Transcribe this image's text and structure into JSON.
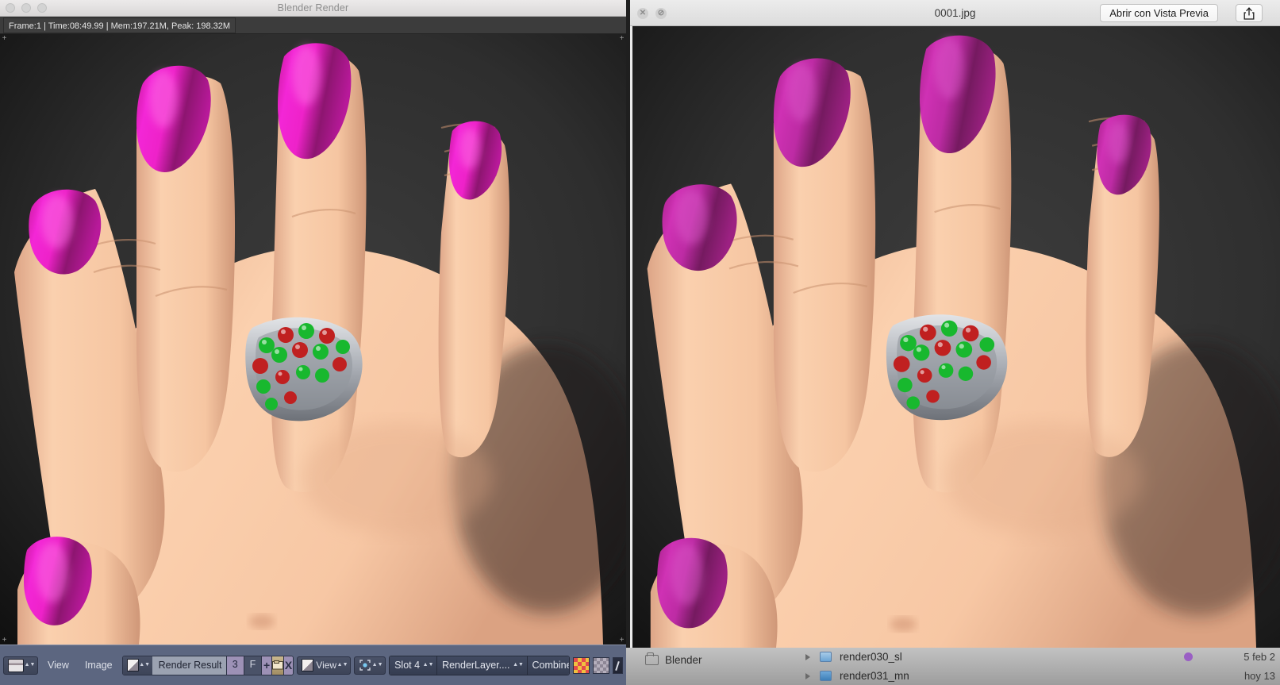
{
  "blender_window": {
    "title": "Blender Render",
    "traffic_lights": [
      "close",
      "minimize",
      "zoom"
    ],
    "status_line": "Frame:1 | Time:08:49.99 | Mem:197.21M, Peak: 198.32M",
    "status_parts": {
      "frame": "Frame:1",
      "time": "Time:08:49.99",
      "memory": "Mem:197.21M, Peak: 198.32M"
    },
    "toolbar": {
      "editor_type_icon": "image-editor-icon",
      "menus": [
        "View",
        "Image"
      ],
      "view_menu": "View",
      "image_menu": "Image",
      "datablock_icon": "image-datablock-icon",
      "datablock_name": "Render Result",
      "users_count": "3",
      "fake_user": "F",
      "new_button": "+",
      "open_button": "open-folder-icon",
      "unlink_button": "X",
      "view_dropdown_icon": "image-view-icon",
      "view_dropdown": "View",
      "pivot_icon": "pivot-center-icon",
      "slot": "Slot 4",
      "render_layer": "RenderLayer....",
      "pass": "Combined",
      "display_channels_icon": "color-channel-icon",
      "alpha_icon": "alpha-checker-icon",
      "grease_pencil_icon": "grease-pencil-icon"
    }
  },
  "preview_window": {
    "title": "0001.jpg",
    "close_icon": "close-icon",
    "disabled_icon": "no-entry-icon",
    "open_with_button": "Abrir con Vista Previa",
    "share_icon": "share-icon"
  },
  "finder": {
    "sidebar_item": "Blender",
    "sidebar_folder_icon": "folder-icon",
    "rows": [
      {
        "disclosure_icon": "disclosure-triangle-icon",
        "file_icon": "folder-blue-icon",
        "name": "render030_sl",
        "tag_color": "#9a5fc4",
        "date": "5 feb 2"
      },
      {
        "disclosure_icon": "disclosure-triangle-icon",
        "file_icon": "folder-blue-icon",
        "name": "render031_mn",
        "tag_color": "",
        "date": "hoy 13"
      }
    ]
  },
  "render_image": {
    "subject": "3D rendered hand with magenta nail polish wearing a gemstone ring",
    "background_color": "#2c2c2c",
    "skin_color": "#f5c3a0",
    "nail_color": "#e01ec0",
    "ring_metal_color": "#b9bcc0",
    "gem_colors": [
      "#18b82e",
      "#c02020"
    ]
  }
}
